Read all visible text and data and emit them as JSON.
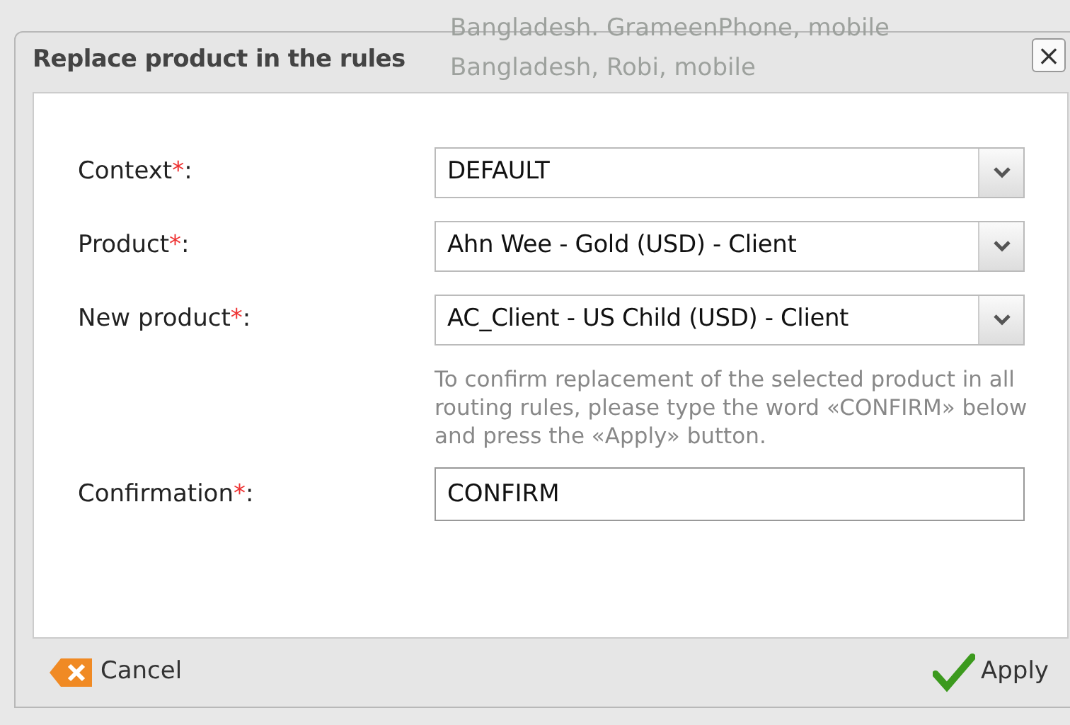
{
  "background_list": [
    "Bangladesh. GrameenPhone, mobile",
    "Bangladesh, Robi, mobile"
  ],
  "dialog": {
    "title": "Replace product in the rules",
    "close": "×",
    "fields": [
      {
        "kind": "select",
        "label": "Context",
        "required": true,
        "value": "DEFAULT"
      },
      {
        "kind": "select",
        "label": "Product",
        "required": true,
        "value": "Ahn Wee - Gold (USD) - Client"
      },
      {
        "kind": "select",
        "label": "New product",
        "required": true,
        "value": "AC_Client - US Child (USD) - Client"
      },
      {
        "kind": "note",
        "text": "To confirm replacement of the selected product in all routing rules, please type the word «CONFIRM» below and press the «Apply» button."
      },
      {
        "kind": "input",
        "label": "Confirmation",
        "required": true,
        "value": "CONFIRM"
      }
    ],
    "required_mark": "*",
    "label_suffix": ":",
    "buttons": [
      {
        "kind": "cancel",
        "label": "Cancel"
      },
      {
        "kind": "apply",
        "label": "Apply"
      }
    ]
  }
}
